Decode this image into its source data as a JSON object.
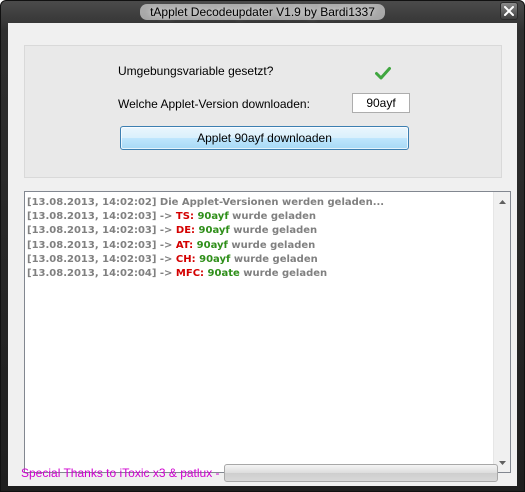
{
  "window": {
    "title": "tApplet Decodeupdater V1.9 by Bardi1337"
  },
  "settings": {
    "env_label": "Umgebungsvariable gesetzt?",
    "env_status_icon": "check-icon",
    "env_status_color": "#3fa63f",
    "version_label": "Welche Applet-Version downloaden:",
    "version_value": "90ayf",
    "download_label": "Applet 90ayf downloaden"
  },
  "log": {
    "colors": {
      "timestamp": "#808080",
      "region": "#d40000",
      "version": "#2f8f1a"
    },
    "lines": [
      {
        "text": "[13.08.2013, 14:02:02] Die Applet-Versionen werden geladen..."
      },
      {
        "timestamp": "[13.08.2013, 14:02:03] -> ",
        "region": "TS:",
        "version": "90ayf",
        "suffix": " wurde geladen"
      },
      {
        "timestamp": "[13.08.2013, 14:02:03] -> ",
        "region": "DE:",
        "version": "90ayf",
        "suffix": " wurde geladen"
      },
      {
        "timestamp": "[13.08.2013, 14:02:03] -> ",
        "region": "AT:",
        "version": "90ayf",
        "suffix": " wurde geladen"
      },
      {
        "timestamp": "[13.08.2013, 14:02:03] -> ",
        "region": "CH:",
        "version": "90ayf",
        "suffix": " wurde geladen"
      },
      {
        "timestamp": "[13.08.2013, 14:02:04] -> ",
        "region": "MFC:",
        "version": "90ate",
        "suffix": " wurde geladen"
      }
    ]
  },
  "footer": {
    "thanks": "Special Thanks to iToxic x3 & patlux -",
    "thanks_color": "#d000d0",
    "progress_percent": 0
  }
}
